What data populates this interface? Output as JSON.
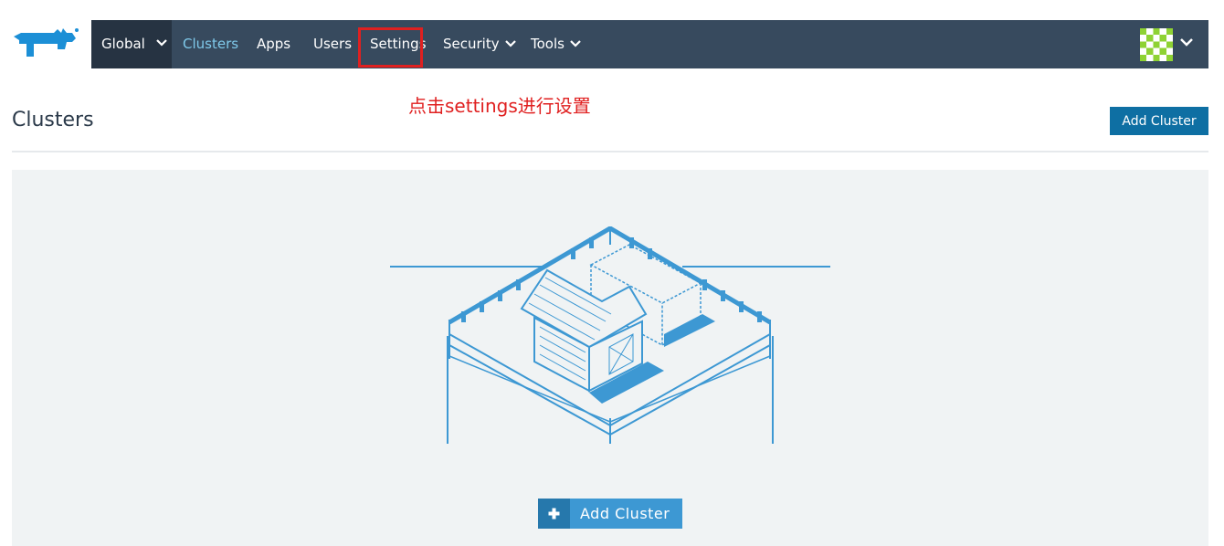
{
  "brand": {
    "logo_icon": "rancher-cow-logo",
    "color": "#1c8fd6"
  },
  "nav": {
    "global_label": "Global",
    "items": [
      {
        "label": "Clusters",
        "active": true
      },
      {
        "label": "Apps"
      },
      {
        "label": "Users"
      },
      {
        "label": "Settings"
      },
      {
        "label": "Security",
        "dropdown": true
      },
      {
        "label": "Tools",
        "dropdown": true
      }
    ],
    "background": "#374a5e",
    "active_color": "#7fc9ea"
  },
  "user": {
    "avatar_icon": "identicon-avatar",
    "menu_icon": "chevron-down-icon"
  },
  "annotation": {
    "text": "点击settings进行设置",
    "color": "#e02020"
  },
  "page": {
    "title": "Clusters",
    "add_button_label": "Add Cluster",
    "empty_state": {
      "illustration_icon": "farm-barn-illustration",
      "add_button_label": "Add Cluster",
      "add_button_icon": "plus-icon"
    }
  }
}
